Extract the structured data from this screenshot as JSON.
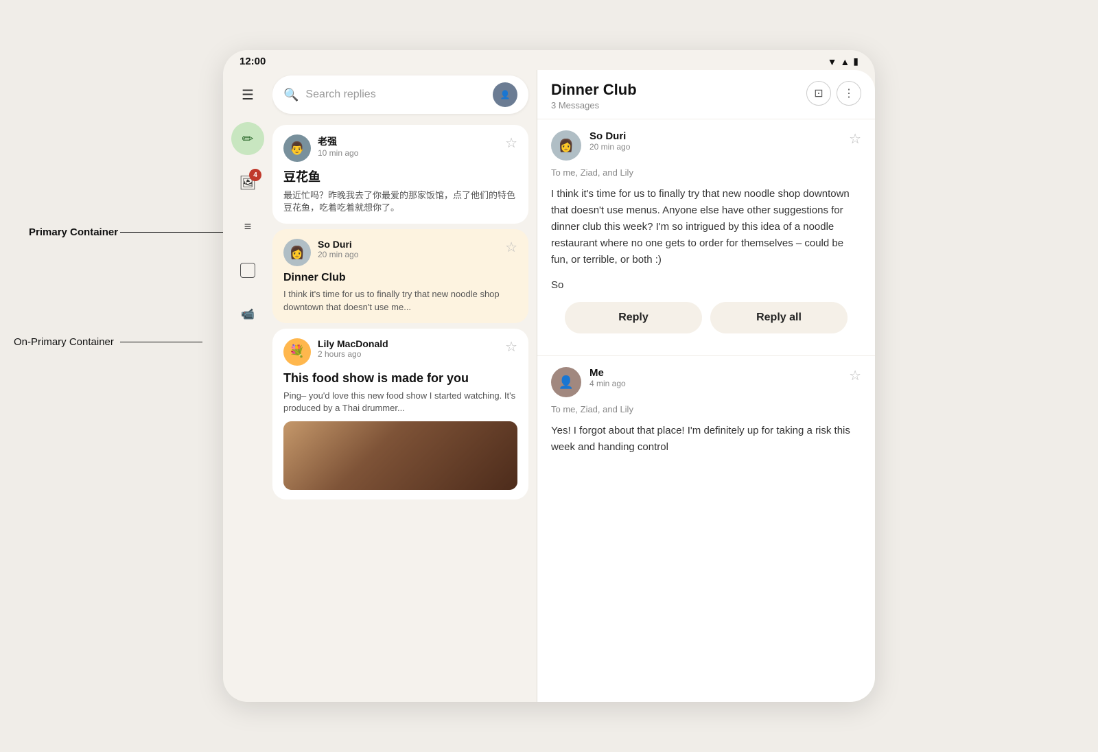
{
  "statusBar": {
    "time": "12:00",
    "icons": [
      "wifi",
      "signal",
      "battery"
    ]
  },
  "sidebar": {
    "icons": [
      {
        "name": "menu",
        "symbol": "☰",
        "active": false,
        "badge": null,
        "label": "menu-icon"
      },
      {
        "name": "compose",
        "symbol": "✏",
        "active": true,
        "badge": null,
        "label": "compose-icon"
      },
      {
        "name": "notifications",
        "symbol": "🖼",
        "active": false,
        "badge": "4",
        "label": "notifications-icon"
      },
      {
        "name": "inbox",
        "symbol": "☰",
        "active": false,
        "badge": null,
        "label": "inbox-icon"
      },
      {
        "name": "chat",
        "symbol": "□",
        "active": false,
        "badge": null,
        "label": "chat-icon"
      },
      {
        "name": "video",
        "symbol": "📹",
        "active": false,
        "badge": null,
        "label": "video-icon"
      }
    ]
  },
  "searchBar": {
    "placeholder": "Search replies"
  },
  "emailList": [
    {
      "sender": "老强",
      "time": "10 min ago",
      "subject": "豆花鱼",
      "preview": "最近忙吗？昨晚我去了你最爱的那家饭馆，点了他们的特色豆花鱼，吃着吃着就想你了。",
      "selected": false,
      "avatarColor": "av-laojian"
    },
    {
      "sender": "So Duri",
      "time": "20 min ago",
      "subject": "Dinner Club",
      "preview": "I think it's time for us to finally try that new noodle shop downtown that doesn't use me...",
      "selected": true,
      "avatarColor": "av-soduri"
    },
    {
      "sender": "Lily MacDonald",
      "time": "2 hours ago",
      "subject": "This food show is made for you",
      "preview": "Ping– you'd love this new food show I started watching. It's produced by a Thai drummer...",
      "selected": false,
      "avatarColor": "av-lily"
    }
  ],
  "detail": {
    "title": "Dinner Club",
    "subtitle": "3 Messages",
    "actions": {
      "square": "⊡",
      "dots": "⋮"
    },
    "messages": [
      {
        "sender": "So Duri",
        "time": "20 min ago",
        "to": "To me, Ziad, and Lily",
        "body": "I think it's time for us to finally try that new noodle shop downtown that doesn't use menus. Anyone else have other suggestions for dinner club this week? I'm so intrigued by this idea of a noodle restaurant where no one gets to order for themselves – could be fun, or terrible, or both :)",
        "signature": "So",
        "avatarColor": "av-soduri"
      },
      {
        "sender": "Me",
        "time": "4 min ago",
        "to": "To me, Ziad, and Lily",
        "body": "Yes! I forgot about that place! I'm definitely up for taking a risk this week and handing control",
        "signature": "",
        "avatarColor": "av-me"
      }
    ],
    "replyButtons": {
      "reply": "Reply",
      "replyAll": "Reply all"
    }
  },
  "labels": {
    "primaryContainer": "Primary Container",
    "onPrimaryContainer": "On-Primary Container"
  }
}
